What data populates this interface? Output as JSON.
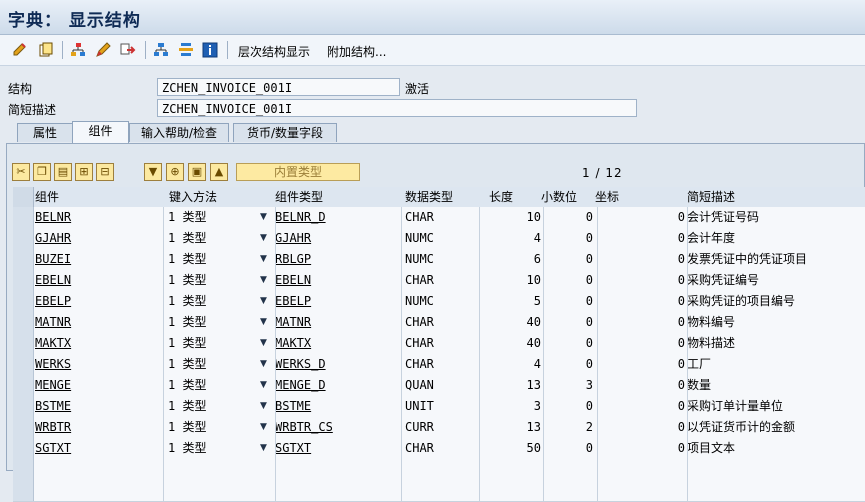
{
  "window": {
    "title": "字典： 显示结构"
  },
  "toolbar": {
    "icons": [
      "edit-icon",
      "copy-icon",
      "hierarchy-icon",
      "pen-icon",
      "move-icon",
      "structure-icon",
      "compare-icon",
      "info-icon"
    ],
    "hierarchy_label": "层次结构显示",
    "append_label": "附加结构..."
  },
  "header": {
    "structure_label": "结构",
    "structure_value": "ZCHEN_INVOICE_001I",
    "status": "激活",
    "desc_label": "简短描述",
    "desc_value": "ZCHEN_INVOICE_001I"
  },
  "tabs": [
    {
      "label": "属性",
      "active": false
    },
    {
      "label": "组件",
      "active": true
    },
    {
      "label": "输入帮助/检查",
      "active": false
    },
    {
      "label": "货币/数量字段",
      "active": false
    }
  ],
  "table_toolbar": {
    "buttons": [
      "cut-icon",
      "copy-icon",
      "paste-icon",
      "insert-row-icon",
      "delete-row-icon",
      "filter-icon",
      "expand-icon",
      "collapse-icon",
      "up-icon"
    ],
    "builtin_label": "内置类型"
  },
  "pager": {
    "current": "1",
    "separator": "/",
    "total": "12"
  },
  "columns": [
    "组件",
    "键入方法",
    "组件类型",
    "数据类型",
    "长度",
    "小数位",
    "坐标",
    "简短描述"
  ],
  "rows": [
    {
      "component": "BELNR",
      "method": "1 类型",
      "type": "BELNR_D",
      "datatype": "CHAR",
      "length": "10",
      "decimals": "0",
      "coord": "0",
      "desc": "会计凭证号码"
    },
    {
      "component": "GJAHR",
      "method": "1 类型",
      "type": "GJAHR",
      "datatype": "NUMC",
      "length": "4",
      "decimals": "0",
      "coord": "0",
      "desc": "会计年度"
    },
    {
      "component": "BUZEI",
      "method": "1 类型",
      "type": "RBLGP",
      "datatype": "NUMC",
      "length": "6",
      "decimals": "0",
      "coord": "0",
      "desc": "发票凭证中的凭证项目"
    },
    {
      "component": "EBELN",
      "method": "1 类型",
      "type": "EBELN",
      "datatype": "CHAR",
      "length": "10",
      "decimals": "0",
      "coord": "0",
      "desc": "采购凭证编号"
    },
    {
      "component": "EBELP",
      "method": "1 类型",
      "type": "EBELP",
      "datatype": "NUMC",
      "length": "5",
      "decimals": "0",
      "coord": "0",
      "desc": "采购凭证的项目编号"
    },
    {
      "component": "MATNR",
      "method": "1 类型",
      "type": "MATNR",
      "datatype": "CHAR",
      "length": "40",
      "decimals": "0",
      "coord": "0",
      "desc": "物料编号"
    },
    {
      "component": "MAKTX",
      "method": "1 类型",
      "type": "MAKTX",
      "datatype": "CHAR",
      "length": "40",
      "decimals": "0",
      "coord": "0",
      "desc": "物料描述"
    },
    {
      "component": "WERKS",
      "method": "1 类型",
      "type": "WERKS_D",
      "datatype": "CHAR",
      "length": "4",
      "decimals": "0",
      "coord": "0",
      "desc": "工厂"
    },
    {
      "component": "MENGE",
      "method": "1 类型",
      "type": "MENGE_D",
      "datatype": "QUAN",
      "length": "13",
      "decimals": "3",
      "coord": "0",
      "desc": "数量"
    },
    {
      "component": "BSTME",
      "method": "1 类型",
      "type": "BSTME",
      "datatype": "UNIT",
      "length": "3",
      "decimals": "0",
      "coord": "0",
      "desc": "采购订单计量单位"
    },
    {
      "component": "WRBTR",
      "method": "1 类型",
      "type": "WRBTR_CS",
      "datatype": "CURR",
      "length": "13",
      "decimals": "2",
      "coord": "0",
      "desc": "以凭证货币计的金额"
    },
    {
      "component": "SGTXT",
      "method": "1 类型",
      "type": "SGTXT",
      "datatype": "CHAR",
      "length": "50",
      "decimals": "0",
      "coord": "0",
      "desc": "项目文本"
    }
  ]
}
